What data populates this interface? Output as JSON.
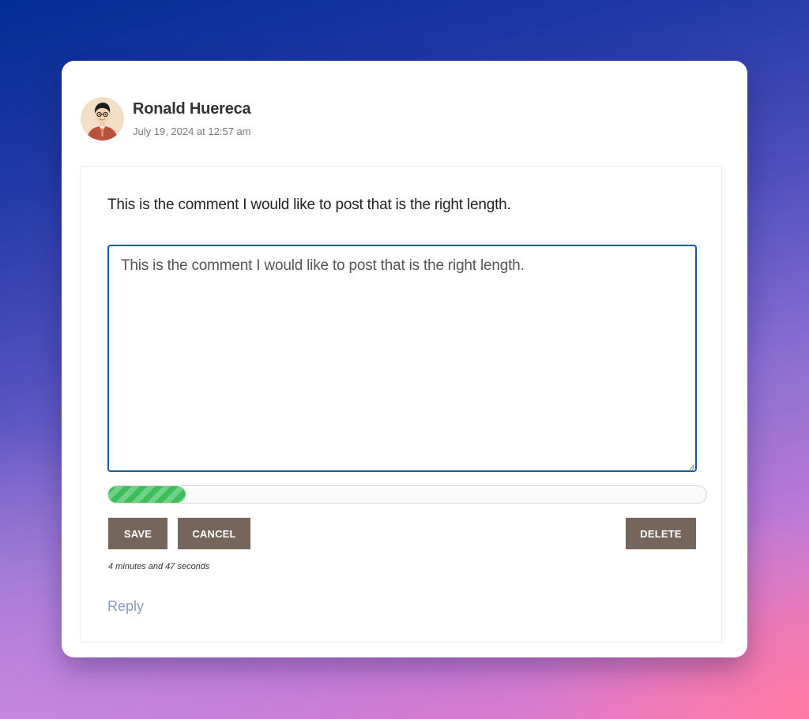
{
  "comment": {
    "author": "Ronald Huereca",
    "timestamp": "July 19, 2024 at 12:57 am",
    "text": "This is the comment I would like to post that is the right length.",
    "avatar_icon": "person-avatar-icon"
  },
  "editor": {
    "value": "This is the comment I would like to post that is the right length."
  },
  "progress": {
    "percent": 13,
    "color": "#3cbf5a"
  },
  "actions": {
    "save_label": "SAVE",
    "cancel_label": "CANCEL",
    "delete_label": "DELETE",
    "button_color": "#75655a"
  },
  "timer": {
    "text": "4 minutes and 47 seconds"
  },
  "reply": {
    "label": "Reply",
    "color": "#8a9bbd"
  },
  "colors": {
    "editor_border": "#1a5c99"
  }
}
